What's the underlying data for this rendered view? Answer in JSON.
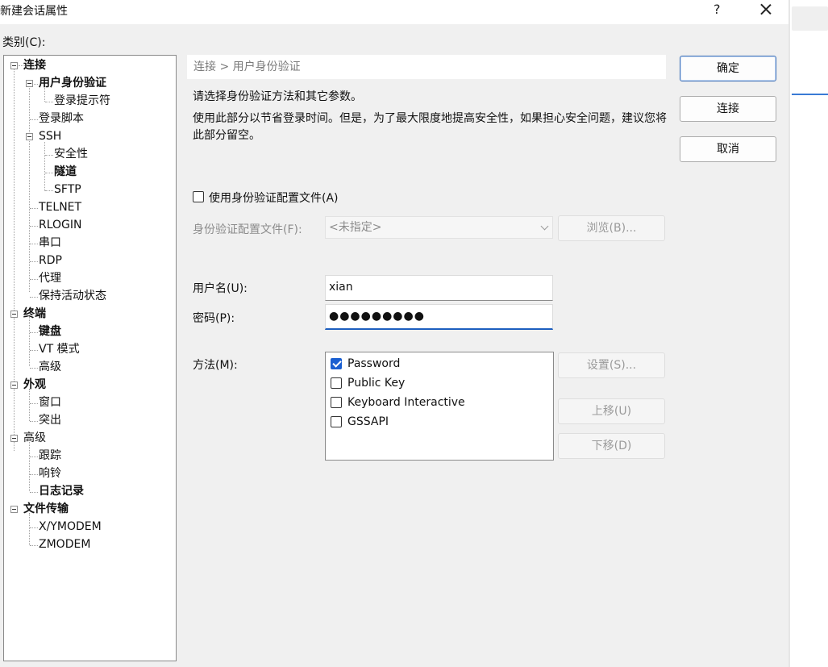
{
  "dialog": {
    "title": "新建会话属性",
    "help": "?",
    "category_label": "类别(C):"
  },
  "tree": {
    "connection": "连接",
    "auth": "用户身份验证",
    "login_prompt": "登录提示符",
    "login_script": "登录脚本",
    "ssh": "SSH",
    "security": "安全性",
    "tunnel": "隧道",
    "sftp": "SFTP",
    "telnet": "TELNET",
    "rlogin": "RLOGIN",
    "serial": "串口",
    "rdp": "RDP",
    "proxy": "代理",
    "keepalive": "保持活动状态",
    "terminal": "终端",
    "keyboard": "键盘",
    "vt_mode": "VT 模式",
    "advanced": "高级",
    "appearance": "外观",
    "window": "窗口",
    "highlight": "突出",
    "advanced2": "高级",
    "trace": "跟踪",
    "bell": "响铃",
    "logging": "日志记录",
    "file_transfer": "文件传输",
    "xymodem": "X/YMODEM",
    "zmodem": "ZMODEM"
  },
  "panel": {
    "breadcrumb": "连接 > 用户身份验证",
    "desc1": "请选择身份验证方法和其它参数。",
    "desc2": "使用此部分以节省登录时间。但是，为了最大限度地提高安全性，如果担心安全问题，建议您将此部分留空。",
    "use_profile_label": "使用身份验证配置文件(A)",
    "use_profile_checked": false,
    "profile_label": "身份验证配置文件(F):",
    "profile_value": "<未指定>",
    "browse": "浏览(B)...",
    "username_label": "用户名(U):",
    "username_value": "xian",
    "password_label": "密码(P):",
    "password_mask": "●●●●●●●●●",
    "method_label": "方法(M):",
    "methods": [
      {
        "label": "Password",
        "checked": true
      },
      {
        "label": "Public Key",
        "checked": false
      },
      {
        "label": "Keyboard Interactive",
        "checked": false
      },
      {
        "label": "GSSAPI",
        "checked": false
      }
    ],
    "settings": "设置(S)...",
    "move_up": "上移(U)",
    "move_down": "下移(D)"
  },
  "buttons": {
    "ok": "确定",
    "connect": "连接",
    "cancel": "取消"
  },
  "colors": {
    "accent": "#1a5fd1",
    "dialog_bg": "#f0f0f0"
  }
}
